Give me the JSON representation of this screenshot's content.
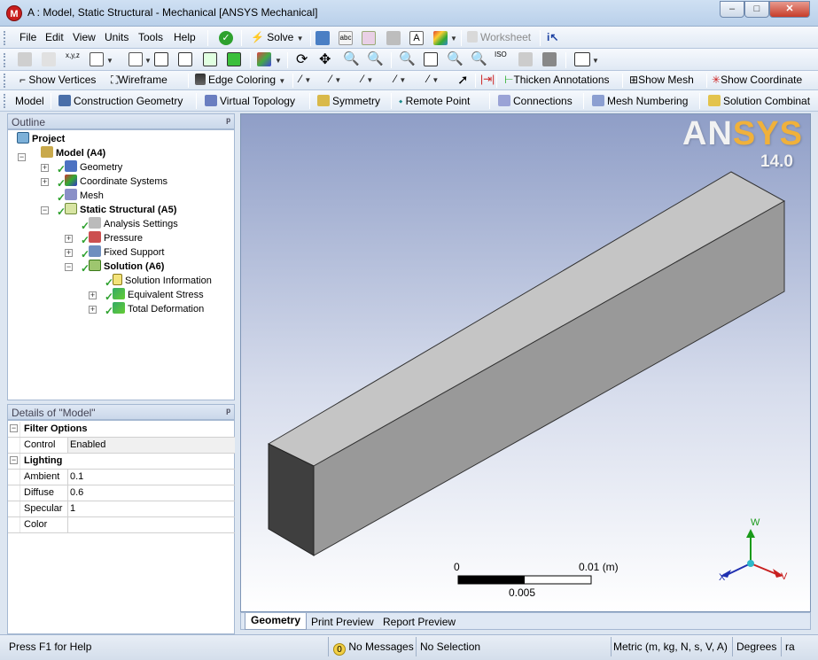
{
  "window": {
    "title": "A : Model, Static Structural - Mechanical [ANSYS Mechanical]",
    "min_glyph": "–",
    "max_glyph": "□",
    "close_glyph": "✕"
  },
  "menu": {
    "items": [
      "File",
      "Edit",
      "View",
      "Units",
      "Tools",
      "Help"
    ],
    "solve_label": "Solve",
    "worksheet_label": "Worksheet"
  },
  "toolbar3": {
    "show_vertices": "Show Vertices",
    "wireframe": "Wireframe",
    "edge_coloring": "Edge Coloring",
    "thicken_annotations": "Thicken Annotations",
    "show_mesh": "Show Mesh",
    "show_coordinate": "Show Coordinate"
  },
  "toolbar4": {
    "model": "Model",
    "construction_geometry": "Construction Geometry",
    "virtual_topology": "Virtual Topology",
    "symmetry": "Symmetry",
    "remote_point": "Remote Point",
    "connections": "Connections",
    "mesh_numbering": "Mesh Numbering",
    "solution_combination": "Solution Combinat"
  },
  "outline": {
    "header": "Outline",
    "pin": "ᵖ",
    "project": "Project",
    "model": "Model (A4)",
    "geometry": "Geometry",
    "coordinate_systems": "Coordinate Systems",
    "mesh": "Mesh",
    "static_structural": "Static Structural (A5)",
    "analysis_settings": "Analysis Settings",
    "pressure": "Pressure",
    "fixed_support": "Fixed Support",
    "solution": "Solution (A6)",
    "solution_information": "Solution Information",
    "equivalent_stress": "Equivalent Stress",
    "total_deformation": "Total Deformation"
  },
  "details": {
    "header": "Details of \"Model\"",
    "filter_options": "Filter Options",
    "control_key": "Control",
    "control_val": "Enabled",
    "lighting": "Lighting",
    "ambient_key": "Ambient",
    "ambient_val": "0.1",
    "diffuse_key": "Diffuse",
    "diffuse_val": "0.6",
    "specular_key": "Specular",
    "specular_val": "1",
    "color_key": "Color",
    "color_val": ""
  },
  "viewport": {
    "logo_an": "AN",
    "logo_sys": "SYS",
    "version": "14.0",
    "scale_zero": "0",
    "scale_max": "0.01 (m)",
    "scale_mid": "0.005",
    "axis_w": "W",
    "axis_v": "V",
    "axis_x": "X"
  },
  "tabs": {
    "geometry": "Geometry",
    "print_preview": "Print Preview",
    "report_preview": "Report Preview"
  },
  "status": {
    "help": "Press F1 for Help",
    "messages": "No Messages",
    "selection": "No Selection",
    "units": "Metric (m, kg, N, s, V, A)",
    "degrees": "Degrees",
    "rad": "ra"
  },
  "colors": {
    "accent": "#f0b13b",
    "check_green": "#2ea12e",
    "brand_red": "#c81d1d"
  }
}
